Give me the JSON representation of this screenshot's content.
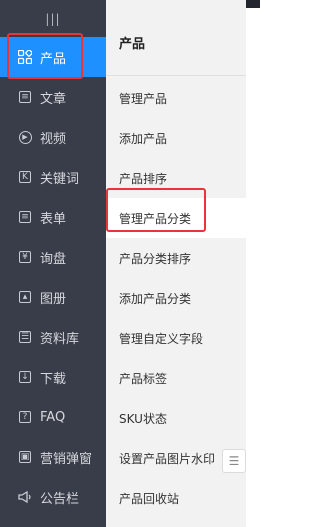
{
  "sidebar": {
    "collapse_glyph": "|||",
    "items": [
      {
        "label": "产品",
        "icon": "grid-icon",
        "active": true
      },
      {
        "label": "文章",
        "icon": "article-icon"
      },
      {
        "label": "视频",
        "icon": "play-icon"
      },
      {
        "label": "关键词",
        "icon": "keyword-icon"
      },
      {
        "label": "表单",
        "icon": "form-icon"
      },
      {
        "label": "询盘",
        "icon": "inquiry-icon"
      },
      {
        "label": "图册",
        "icon": "album-icon"
      },
      {
        "label": "资料库",
        "icon": "database-icon"
      },
      {
        "label": "下载",
        "icon": "download-icon"
      },
      {
        "label": "FAQ",
        "icon": "faq-icon"
      },
      {
        "label": "营销弹窗",
        "icon": "popup-icon"
      },
      {
        "label": "公告栏",
        "icon": "announcement-icon"
      }
    ]
  },
  "submenu": {
    "title": "产品",
    "items": [
      {
        "label": "管理产品"
      },
      {
        "label": "添加产品"
      },
      {
        "label": "产品排序"
      },
      {
        "label": "管理产品分类",
        "active": true
      },
      {
        "label": "产品分类排序"
      },
      {
        "label": "添加产品分类"
      },
      {
        "label": "管理自定义字段"
      },
      {
        "label": "产品标签"
      },
      {
        "label": "SKU状态"
      },
      {
        "label": "设置产品图片水印"
      },
      {
        "label": "产品回收站"
      }
    ]
  },
  "colors": {
    "sidebar_bg": "#393d49",
    "active_bg": "#1e90ff",
    "highlight_frame": "#e8353a",
    "panel_bg": "#f2f2f2"
  }
}
